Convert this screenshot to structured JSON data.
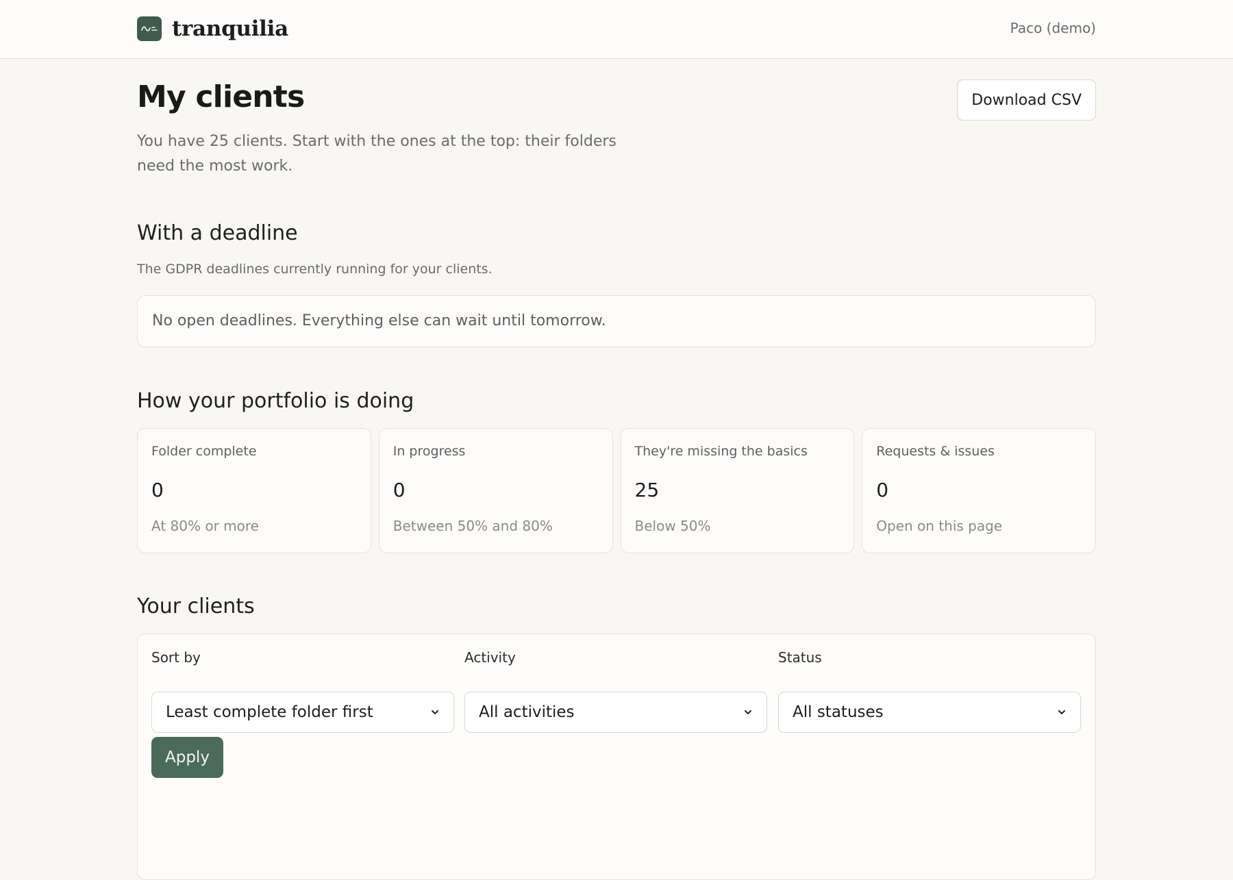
{
  "header": {
    "brand": "tranquilia",
    "user": "Paco (demo)"
  },
  "page": {
    "title": "My clients",
    "download_label": "Download CSV",
    "intro": "You have 25 clients. Start with the ones at the top: their folders need the most work."
  },
  "deadlines": {
    "title": "With a deadline",
    "subtitle": "The GDPR deadlines currently running for your clients.",
    "empty_message": "No open deadlines. Everything else can wait until tomorrow."
  },
  "portfolio": {
    "title": "How your portfolio is doing",
    "cards": [
      {
        "label": "Folder complete",
        "value": "0",
        "note": "At 80% or more"
      },
      {
        "label": "In progress",
        "value": "0",
        "note": "Between 50% and 80%"
      },
      {
        "label": "They're missing the basics",
        "value": "25",
        "note": "Below 50%"
      },
      {
        "label": "Requests & issues",
        "value": "0",
        "note": "Open on this page"
      }
    ]
  },
  "clients": {
    "title": "Your clients",
    "filters": {
      "sort": {
        "label": "Sort by",
        "value": "Least complete folder first"
      },
      "activity": {
        "label": "Activity",
        "value": "All activities"
      },
      "status": {
        "label": "Status",
        "value": "All statuses"
      }
    },
    "apply_label": "Apply"
  },
  "colors": {
    "background": "#f9f7f4",
    "surface": "#fdfcfa",
    "brand_green": "#3f5a4e",
    "apply_green": "#4a6b5a"
  }
}
